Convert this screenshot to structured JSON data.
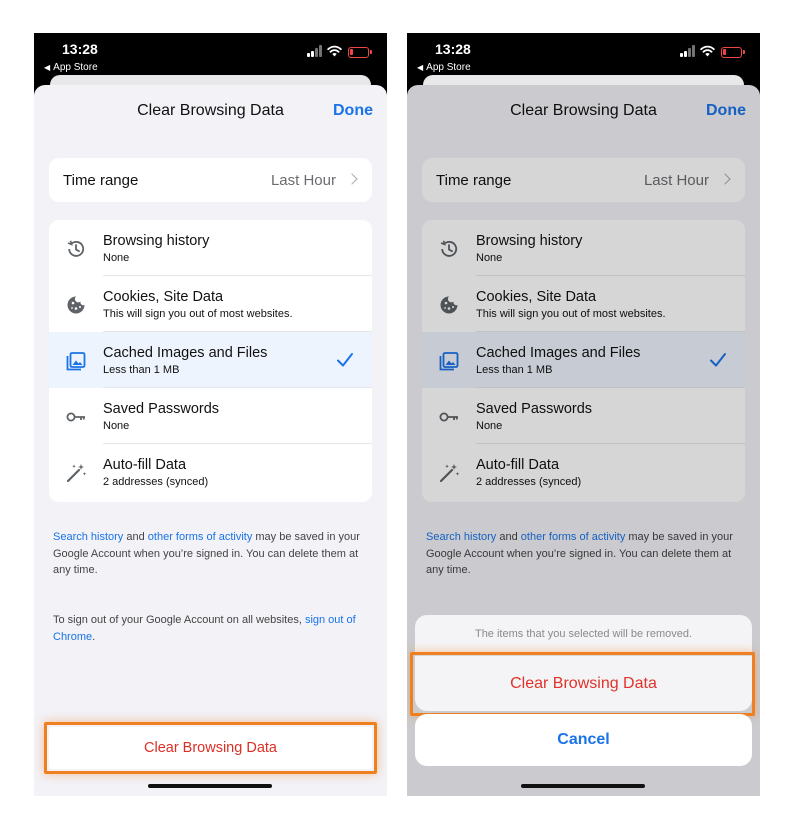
{
  "status_bar": {
    "time": "13:28",
    "back_app": "App Store"
  },
  "sheet": {
    "title": "Clear Browsing Data",
    "done": "Done"
  },
  "time_range": {
    "label": "Time range",
    "value": "Last Hour"
  },
  "items": [
    {
      "title": "Browsing history",
      "subtitle": "None",
      "selected": false,
      "icon": "history-icon"
    },
    {
      "title": "Cookies, Site Data",
      "subtitle": "This will sign you out of most websites.",
      "selected": false,
      "icon": "cookie-icon"
    },
    {
      "title": "Cached Images and Files",
      "subtitle": "Less than 1 MB",
      "selected": true,
      "icon": "image-icon"
    },
    {
      "title": "Saved Passwords",
      "subtitle": "None",
      "selected": false,
      "icon": "key-icon"
    },
    {
      "title": "Auto-fill Data",
      "subtitle": "2 addresses (synced)",
      "selected": false,
      "icon": "magic-wand-icon"
    }
  ],
  "footer1": {
    "link1": "Search history",
    "and": " and ",
    "link2": "other forms of activity",
    "rest": " may be saved in your Google Account when you’re signed in. You can delete them at any time."
  },
  "footer2": {
    "text": "To sign out of your Google Account on all websites, ",
    "link": "sign out of Chrome",
    "end": "."
  },
  "clear_button": "Clear Browsing Data",
  "action_sheet": {
    "message": "The items that you selected will be removed.",
    "confirm": "Clear Browsing Data",
    "cancel": "Cancel"
  },
  "colors": {
    "accent": "#1a73e8",
    "destructive": "#d93025",
    "highlight": "#f07f1f"
  }
}
